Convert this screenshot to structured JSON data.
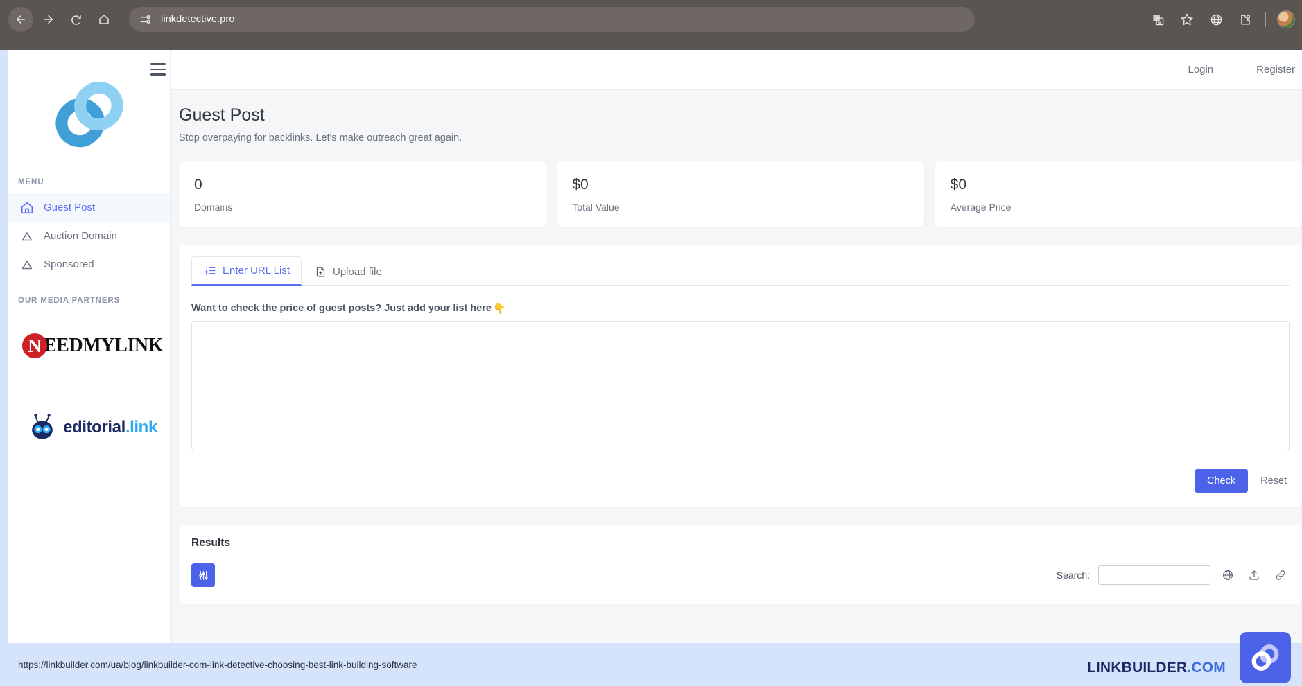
{
  "browser": {
    "url": "linkdetective.pro",
    "back_icon": "back-arrow-icon",
    "forward_icon": "forward-arrow-icon",
    "reload_icon": "reload-icon",
    "home_icon": "home-icon",
    "site_info_icon": "site-settings-icon",
    "translate_icon": "translate-icon",
    "bookmark_icon": "star-icon",
    "globe_icon": "globe-icon",
    "extensions_icon": "extensions-puzzle-icon",
    "profile_icon": "profile-avatar"
  },
  "sidebar": {
    "logo": "chain-link-logo",
    "menu_label": "MENU",
    "items": [
      {
        "label": "Guest Post",
        "icon": "home-icon",
        "active": true
      },
      {
        "label": "Auction Domain",
        "icon": "triangle-icon",
        "active": false
      },
      {
        "label": "Sponsored",
        "icon": "triangle-icon",
        "active": false
      }
    ],
    "partners_label": "OUR MEDIA PARTNERS",
    "partners": [
      {
        "name": "NEEDMYLINK",
        "badge_letter": "N",
        "text": "EEDMYLINK",
        "color": "#cf2027"
      },
      {
        "name": "editorial.link",
        "text": "editorial",
        "suffix": ".link",
        "color": "#2aa8f2"
      }
    ]
  },
  "topbar": {
    "menu_toggle": "hamburger-icon",
    "login": "Login",
    "register": "Register"
  },
  "page": {
    "title": "Guest Post",
    "subtitle": "Stop overpaying for backlinks. Let's make outreach great again."
  },
  "stats": [
    {
      "value": "0",
      "label": "Domains"
    },
    {
      "value": "$0",
      "label": "Total Value"
    },
    {
      "value": "$0",
      "label": "Average Price"
    }
  ],
  "input_panel": {
    "tabs": [
      {
        "label": "Enter URL List",
        "icon": "ordered-list-icon",
        "active": true
      },
      {
        "label": "Upload file",
        "icon": "file-upload-icon",
        "active": false
      }
    ],
    "field_label": "Want to check the price of guest posts? Just add your list here",
    "hand_emoji": "👇",
    "textarea_value": "",
    "textarea_placeholder": "",
    "check_label": "Check",
    "reset_label": "Reset"
  },
  "results": {
    "title": "Results",
    "filter_icon": "sliders-filter-icon",
    "search_label": "Search:",
    "search_value": "",
    "search_placeholder": "",
    "actions": [
      {
        "icon": "copy-icon"
      },
      {
        "icon": "export-upload-icon"
      },
      {
        "icon": "link-icon"
      }
    ]
  },
  "statusbar": {
    "url": "https://linkbuilder.com/ua/blog/linkbuilder-com-link-detective-choosing-best-link-building-software"
  },
  "watermark": {
    "text": "LINKBUILDER",
    "suffix": ".COM",
    "badge_icon": "chain-link-badge-icon",
    "accent": "#4c62e8"
  }
}
